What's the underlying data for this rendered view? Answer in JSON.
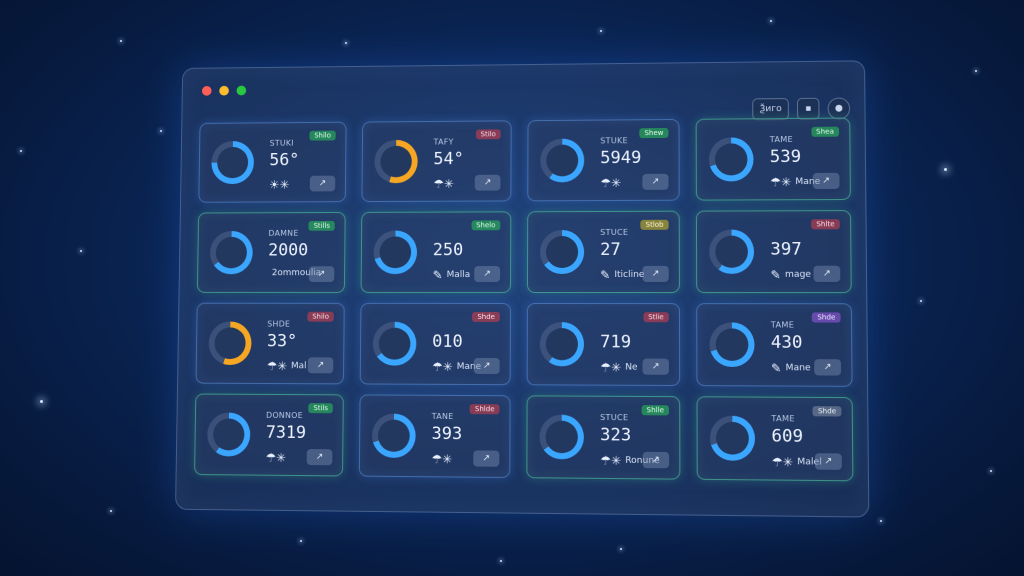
{
  "window": {
    "toolbar": {
      "filter_label": "Ѯиго"
    }
  },
  "cards": [
    {
      "label": "STUKI",
      "value": "56°",
      "sub": "",
      "icon": "snowflake-icon",
      "tag": "Shilo",
      "tag_color": "green",
      "ring_color": "#3aa6ff",
      "ring_pct": 0.75,
      "green": false
    },
    {
      "label": "TAFY",
      "value": "54°",
      "sub": "",
      "icon": "weather-icon",
      "tag": "Stilo",
      "tag_color": "red",
      "ring_color": "#f5a623",
      "ring_pct": 0.55,
      "green": false
    },
    {
      "label": "STUKE",
      "value": "5949",
      "sub": "",
      "icon": "weather-icon",
      "tag": "Shew",
      "tag_color": "green",
      "ring_color": "#3aa6ff",
      "ring_pct": 0.6,
      "green": false
    },
    {
      "label": "TAME",
      "value": "539",
      "sub": "Mane",
      "icon": "weather-icon",
      "tag": "Shea",
      "tag_color": "green",
      "ring_color": "#3aa6ff",
      "ring_pct": 0.7,
      "green": true
    },
    {
      "label": "DAMNE",
      "value": "2000",
      "sub": "2ommoulia",
      "icon": "",
      "tag": "Stills",
      "tag_color": "green",
      "ring_color": "#3aa6ff",
      "ring_pct": 0.65,
      "green": true
    },
    {
      "label": "",
      "value": "250",
      "sub": "Malla",
      "icon": "pencil-icon",
      "tag": "Shelo",
      "tag_color": "green",
      "ring_color": "#3aa6ff",
      "ring_pct": 0.7,
      "green": true
    },
    {
      "label": "STUCE",
      "value": "27",
      "sub": "Iticline",
      "icon": "pencil-icon",
      "tag": "Stlob",
      "tag_color": "yellow",
      "ring_color": "#3aa6ff",
      "ring_pct": 0.65,
      "green": true
    },
    {
      "label": "",
      "value": "397",
      "sub": "mage",
      "icon": "pencil-icon",
      "tag": "Shlte",
      "tag_color": "red",
      "ring_color": "#3aa6ff",
      "ring_pct": 0.6,
      "green": true
    },
    {
      "label": "SHDE",
      "value": "33°",
      "sub": "Mal",
      "icon": "weather-icon",
      "tag": "Shilo",
      "tag_color": "red",
      "ring_color": "#f5a623",
      "ring_pct": 0.55,
      "green": false
    },
    {
      "label": "",
      "value": "010",
      "sub": "Mane",
      "icon": "weather-icon",
      "tag": "Shde",
      "tag_color": "red",
      "ring_color": "#3aa6ff",
      "ring_pct": 0.65,
      "green": false
    },
    {
      "label": "",
      "value": "719",
      "sub": "Ne",
      "icon": "weather-icon",
      "tag": "Stlie",
      "tag_color": "red",
      "ring_color": "#3aa6ff",
      "ring_pct": 0.6,
      "green": false
    },
    {
      "label": "TAME",
      "value": "430",
      "sub": "Mane",
      "icon": "pencil-icon",
      "tag": "Shde",
      "tag_color": "purple",
      "ring_color": "#3aa6ff",
      "ring_pct": 0.7,
      "green": false
    },
    {
      "label": "DONNOE",
      "value": "7319",
      "sub": "",
      "icon": "weather-icon",
      "tag": "Stils",
      "tag_color": "green",
      "ring_color": "#3aa6ff",
      "ring_pct": 0.6,
      "green": true
    },
    {
      "label": "TANE",
      "value": "393",
      "sub": "",
      "icon": "weather-icon",
      "tag": "Shlde",
      "tag_color": "red",
      "ring_color": "#3aa6ff",
      "ring_pct": 0.7,
      "green": false
    },
    {
      "label": "STUCE",
      "value": "323",
      "sub": "Ronune",
      "icon": "weather-icon",
      "tag": "Shlle",
      "tag_color": "green",
      "ring_color": "#3aa6ff",
      "ring_pct": 0.65,
      "green": true
    },
    {
      "label": "TAME",
      "value": "609",
      "sub": "Malel",
      "icon": "weather-icon",
      "tag": "Shde",
      "tag_color": "gray",
      "ring_color": "#3aa6ff",
      "ring_pct": 0.7,
      "green": true
    }
  ]
}
